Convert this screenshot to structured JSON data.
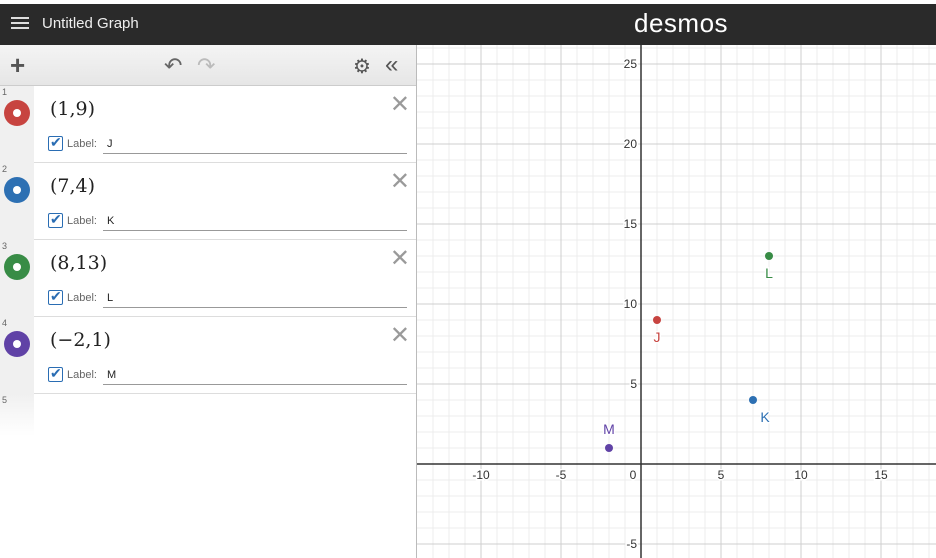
{
  "app": {
    "title": "Untitled Graph",
    "brand": "desmos"
  },
  "toolbar": {
    "add_icon": "plus-icon",
    "undo_icon": "undo-icon",
    "redo_icon": "redo-icon",
    "settings_icon": "gear-icon",
    "collapse_icon": "double-chevron-left-icon"
  },
  "expressions": [
    {
      "index": "1",
      "latex": "(1,9)",
      "label_text": "Label:",
      "label_value": "J",
      "color": "#c74440",
      "x": 1,
      "y": 9
    },
    {
      "index": "2",
      "latex": "(7,4)",
      "label_text": "Label:",
      "label_value": "K",
      "color": "#2d70b3",
      "x": 7,
      "y": 4
    },
    {
      "index": "3",
      "latex": "(8,13)",
      "label_text": "Label:",
      "label_value": "L",
      "color": "#388c46",
      "x": 8,
      "y": 13
    },
    {
      "index": "4",
      "latex": "(−2,1)",
      "label_text": "Label:",
      "label_value": "M",
      "color": "#6042a6",
      "x": -2,
      "y": 1
    }
  ],
  "empty_row_index": "5",
  "graph": {
    "x_ticks": [
      "-10",
      "-5",
      "0",
      "5",
      "10",
      "15"
    ],
    "y_ticks": [
      "25",
      "20",
      "15",
      "10",
      "5",
      "-5"
    ],
    "x_range": [
      -13.5,
      18.5
    ],
    "y_range": [
      -5.5,
      26.5
    ]
  }
}
